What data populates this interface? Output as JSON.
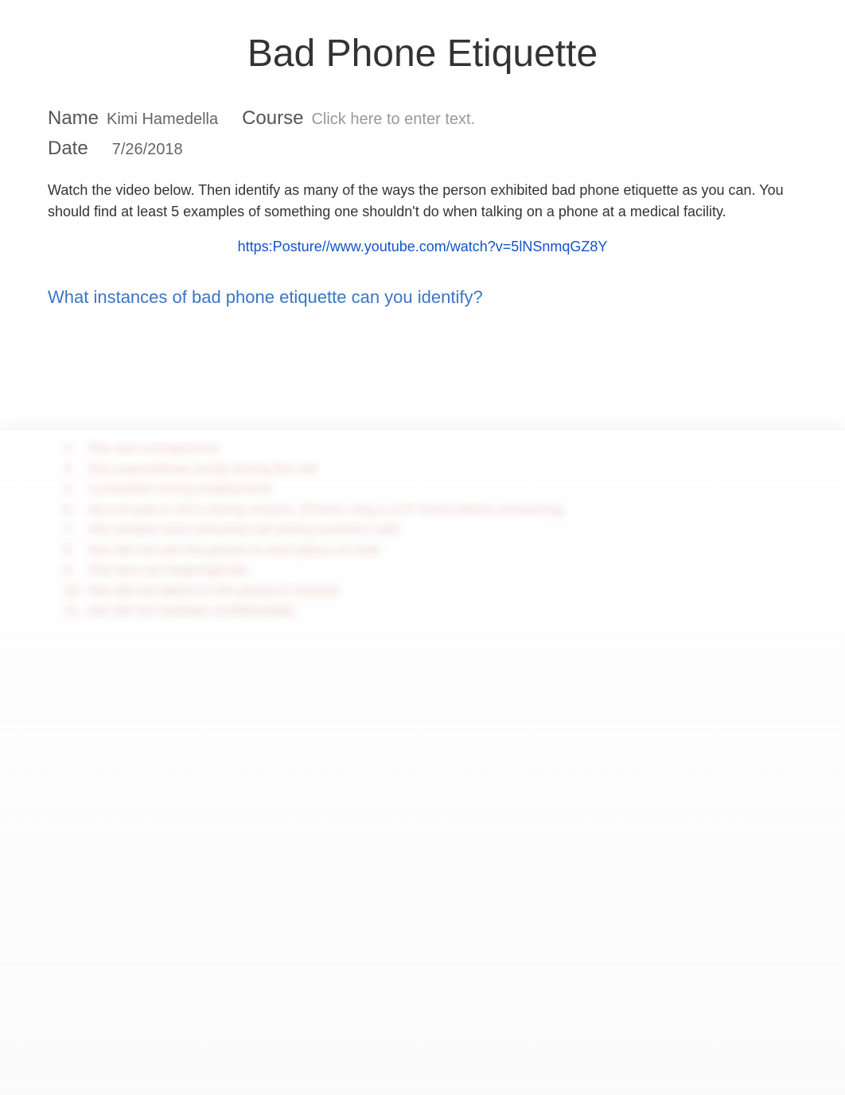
{
  "title": "Bad Phone Etiquette",
  "name_label": "Name",
  "name_value": "Kimi Hamedella",
  "course_label": "Course",
  "course_placeholder": "Click here to enter text.",
  "date_label": "Date",
  "date_value": "7/26/2018",
  "instructions": "Watch the video below. Then identify as many of the ways the person exhibited bad phone etiquette as you can. You should find at least 5 examples of something one shouldn't do when talking on a phone at a medical facility.",
  "video_link": "https:Posture//www.youtube.com/watch?v=5lNSnmqGZ8Y",
  "question": "What instances of bad phone etiquette can you identify?",
  "blurred_items": [
    "She was unorganized",
    "She yawned/was loudly during the call",
    "Cursed/the wrong employment",
    "did not wait or did it during closure. (Phone rang a LOT times before answering)",
    "She started more personal call during business calls",
    "She did not ask the person to wait /place on hold",
    "She was not forgiving/rude",
    "She did not attend to the person's request",
    "she did not maintain confidentiality"
  ]
}
